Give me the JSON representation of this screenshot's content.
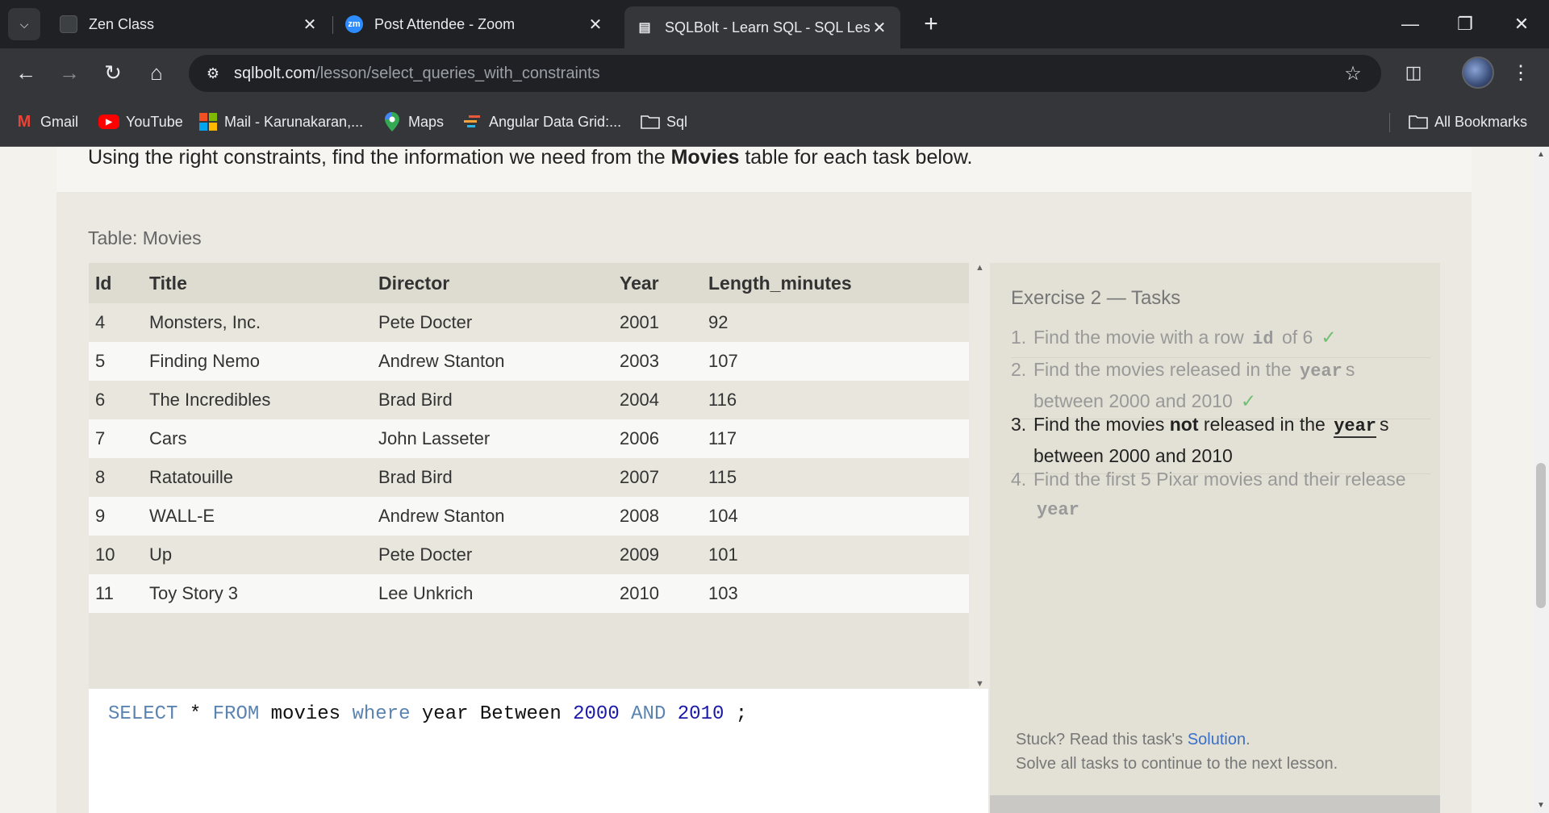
{
  "browser": {
    "tabs": [
      {
        "title": "Zen Class",
        "icon": "zen-class-favicon"
      },
      {
        "title": "Post Attendee - Zoom",
        "icon": "zoom-favicon",
        "icon_text": "zm"
      },
      {
        "title": "SQLBolt - Learn SQL - SQL Less",
        "icon": "sqlbolt-favicon",
        "active": true
      }
    ],
    "url_domain": "sqlbolt.com",
    "url_path": "/lesson/select_queries_with_constraints",
    "bookmarks": [
      "Gmail",
      "YouTube",
      "Mail - Karunakaran,...",
      "Maps",
      "Angular Data Grid:...",
      "Sql"
    ],
    "all_bookmarks": "All Bookmarks"
  },
  "lesson": {
    "intro_pre": "Using the right constraints, find the information we need from the ",
    "intro_bold": "Movies",
    "intro_post": " table for each task below.",
    "table_caption": "Table: Movies"
  },
  "movies_table": {
    "columns": [
      "Id",
      "Title",
      "Director",
      "Year",
      "Length_minutes"
    ],
    "rows": [
      [
        "4",
        "Monsters, Inc.",
        "Pete Docter",
        "2001",
        "92"
      ],
      [
        "5",
        "Finding Nemo",
        "Andrew Stanton",
        "2003",
        "107"
      ],
      [
        "6",
        "The Incredibles",
        "Brad Bird",
        "2004",
        "116"
      ],
      [
        "7",
        "Cars",
        "John Lasseter",
        "2006",
        "117"
      ],
      [
        "8",
        "Ratatouille",
        "Brad Bird",
        "2007",
        "115"
      ],
      [
        "9",
        "WALL-E",
        "Andrew Stanton",
        "2008",
        "104"
      ],
      [
        "10",
        "Up",
        "Pete Docter",
        "2009",
        "101"
      ],
      [
        "11",
        "Toy Story 3",
        "Lee Unkrich",
        "2010",
        "103"
      ]
    ]
  },
  "editor": {
    "tokens": [
      {
        "t": "SELECT",
        "k": "kw"
      },
      {
        "t": " * ",
        "k": ""
      },
      {
        "t": "FROM",
        "k": "kw"
      },
      {
        "t": " movies ",
        "k": ""
      },
      {
        "t": "where",
        "k": "kw"
      },
      {
        "t": " year Between ",
        "k": ""
      },
      {
        "t": "2000",
        "k": "num"
      },
      {
        "t": " ",
        "k": ""
      },
      {
        "t": "AND",
        "k": "kw"
      },
      {
        "t": " ",
        "k": ""
      },
      {
        "t": "2010",
        "k": "num"
      },
      {
        "t": " ;",
        "k": ""
      }
    ]
  },
  "tasks": {
    "title": "Exercise 2 — Tasks",
    "items": [
      {
        "num": "1.",
        "pre": "Find the movie with a row ",
        "code": "id",
        "post": " of 6",
        "line2": "",
        "done": true,
        "current": false
      },
      {
        "num": "2.",
        "pre": "Find the movies released in the ",
        "code": "year",
        "post": "s",
        "line2": "between 2000 and 2010",
        "done": true,
        "current": false
      },
      {
        "num": "3.",
        "pre": "Find the movies ",
        "bold": "not",
        "pre2": " released in the ",
        "code": "year",
        "post": "s",
        "line2": "between 2000 and 2010",
        "done": false,
        "current": true
      },
      {
        "num": "4.",
        "pre": "Find the first 5 Pixar movies and their release",
        "code": "year",
        "post": "",
        "line2": "",
        "done": false,
        "current": false
      }
    ],
    "check": "✓",
    "stuck_pre": "Stuck? Read this task's ",
    "stuck_link": "Solution",
    "stuck_post": ".",
    "continue_text": "Solve all tasks to continue to the next lesson."
  }
}
